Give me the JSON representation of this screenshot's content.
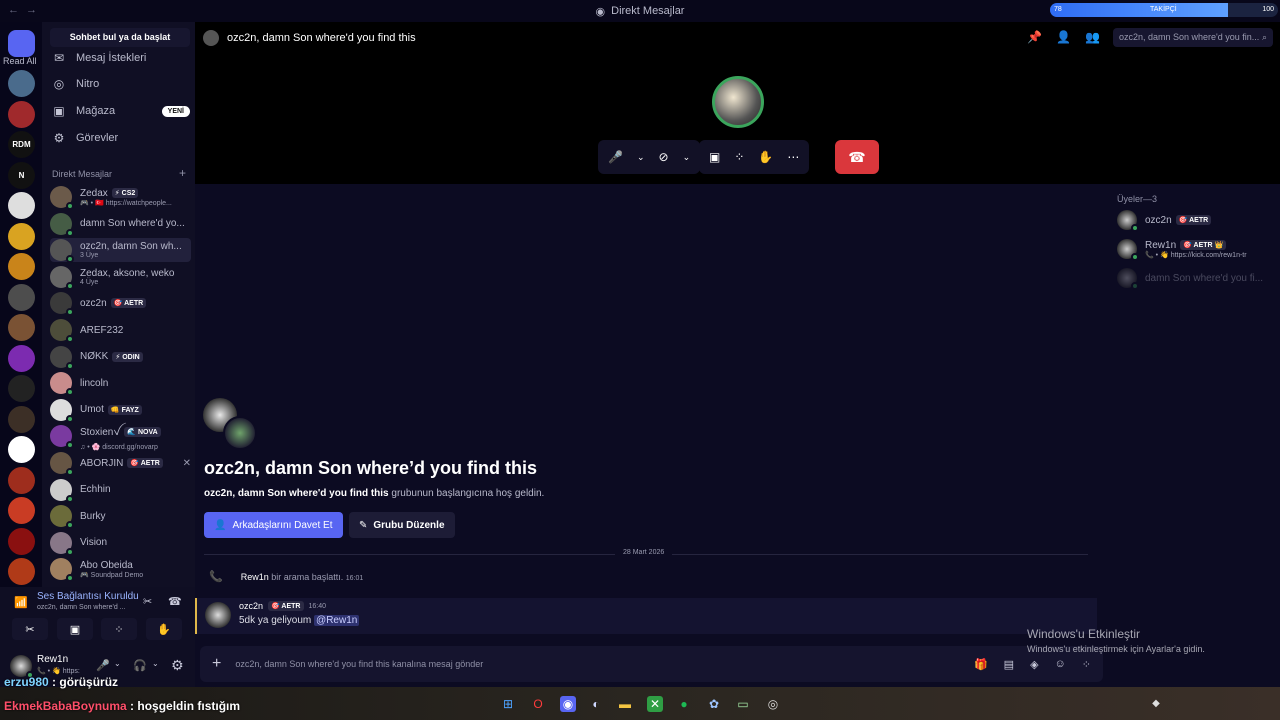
{
  "window": {
    "title": "Direkt Mesajlar",
    "nav": "← →"
  },
  "follower_bar": {
    "left": "78",
    "label": "TAKİPÇİ",
    "right": "100",
    "progress": 0.78
  },
  "servers": {
    "read_all": "Read All",
    "items": [
      {
        "name": "discord-home",
        "color": "#5865f2"
      },
      {
        "name": "server-1",
        "color": "#4a6b8c"
      },
      {
        "name": "server-2",
        "color": "#a0292c"
      },
      {
        "name": "server-rdm",
        "color": "#111",
        "text": "RDM"
      },
      {
        "name": "server-n",
        "color": "#111",
        "text": "N"
      },
      {
        "name": "server-5",
        "color": "#dedede"
      },
      {
        "name": "server-6",
        "color": "#d9a321"
      },
      {
        "name": "server-7",
        "color": "#c9841a"
      },
      {
        "name": "server-8",
        "color": "#4d4d4d"
      },
      {
        "name": "server-9",
        "color": "#7a5234"
      },
      {
        "name": "server-10",
        "color": "#7c2bb0"
      },
      {
        "name": "server-11",
        "color": "#222"
      },
      {
        "name": "server-12",
        "color": "#3c2f26"
      },
      {
        "name": "server-13",
        "color": "#fff"
      },
      {
        "name": "server-14",
        "color": "#9e2d1d"
      },
      {
        "name": "server-15",
        "color": "#c93c24"
      },
      {
        "name": "server-16",
        "color": "#8a1010"
      },
      {
        "name": "server-17",
        "color": "#b03a18"
      }
    ]
  },
  "sidebar": {
    "find": "Sohbet bul ya da başlat",
    "nav": [
      {
        "label": "Mesaj İstekleri",
        "icon": "✉"
      },
      {
        "label": "Nitro",
        "icon": "◎"
      },
      {
        "label": "Mağaza",
        "icon": "▣",
        "badge": "YENİ"
      },
      {
        "label": "Görevler",
        "icon": "⚙"
      }
    ],
    "dm_header": "Direkt Mesajlar",
    "dm_add": "+",
    "dms": [
      {
        "name": "Zedax",
        "tag": "⚡ CS2",
        "sub": "🎮 • 🇹🇷 https://watchpeople...",
        "color": "#6b5a4a"
      },
      {
        "name": "damn Son where'd yo...",
        "tag": "",
        "sub": "",
        "color": "#455c45"
      },
      {
        "name": "ozc2n, damn Son wh...",
        "tag": "",
        "sub": "3 Üye",
        "color": "#555",
        "sel": true
      },
      {
        "name": "Zedax, aksone, weko",
        "tag": "",
        "sub": "4 Üye",
        "color": "#666"
      },
      {
        "name": "ozc2n",
        "tag": "🎯 AETR",
        "sub": "",
        "color": "#3a3a3a"
      },
      {
        "name": "AREF232",
        "tag": "",
        "sub": "",
        "color": "#4d4d3a"
      },
      {
        "name": "NØKK",
        "tag": "⚡ ODIN",
        "sub": "",
        "color": "#444"
      },
      {
        "name": "lincoln",
        "tag": "",
        "sub": "",
        "color": "#c98c8c"
      },
      {
        "name": "Umot",
        "tag": "👊 FAYZ",
        "sub": "",
        "color": "#ddd"
      },
      {
        "name": "Stoxienꪜ",
        "tag": "🌊 NOVA",
        "sub": "♫ • 🌸 discord.gg/novarp",
        "color": "#7a3aa0"
      },
      {
        "name": "ABORJİN",
        "tag": "🎯 AETR",
        "sub": "",
        "color": "#665544",
        "x": "✕"
      },
      {
        "name": "Echhin",
        "tag": "",
        "sub": "",
        "color": "#ccc"
      },
      {
        "name": "Burky",
        "tag": "",
        "sub": "",
        "color": "#6b6b3a"
      },
      {
        "name": "Vision",
        "tag": "",
        "sub": "",
        "color": "#887788"
      },
      {
        "name": "Abo Obeida",
        "tag": "",
        "sub": "🎮 Soundpad Demo",
        "color": "#a08060"
      }
    ]
  },
  "voice": {
    "title": "Ses Bağlantısı Kuruldu",
    "sub": "ozc2n, damn Son where'd ...",
    "buttons": [
      "✂",
      "▣",
      "⁘",
      "✋"
    ]
  },
  "user": {
    "name": "Rew1n",
    "status": "📞 • 👋 https:"
  },
  "channel": {
    "name": "ozc2n, damn Son where'd you find this",
    "search": "ozc2n, damn Son where'd you fin..."
  },
  "call_controls": {
    "mic": "🎤",
    "cam": "⊘",
    "share": "▣",
    "apps": "⁘",
    "activity": "✋",
    "more": "⋯",
    "hangup": "☎"
  },
  "members": {
    "header": "Üyeler—3",
    "list": [
      {
        "name": "ozc2n",
        "tag": "🎯 AETR",
        "sub": ""
      },
      {
        "name": "Rew1n",
        "tag": "🎯 AETR 👑",
        "sub": "📞 • 👋 https://kick.com/rew1n-tr"
      },
      {
        "name": "damn Son where'd you fi...",
        "tag": "",
        "sub": "",
        "dim": true
      }
    ]
  },
  "welcome": {
    "title": "ozc2n, damn Son where’d you find this",
    "sub_bold": "ozc2n, damn Son where'd you find this",
    "sub_rest": " grubunun başlangıcına hoş geldin.",
    "invite": "Arkadaşlarını Davet Et",
    "edit": "Grubu Düzenle"
  },
  "date_divider": "28 Mart 2026",
  "system_message": {
    "user": "Rew1n",
    "text": " bir arama başlattı.",
    "time": "16:01"
  },
  "message": {
    "user": "ozc2n",
    "tag": "🎯 AETR",
    "time": "16:40",
    "body": "5dk ya geliyoum ",
    "mention": "@Rew1n"
  },
  "composer": {
    "placeholder": "ozc2n, damn Son where'd you find this kanalına mesaj gönder"
  },
  "activation": {
    "title": "Windows'u Etkinleştir",
    "sub": "Windows'u etkinleştirmek için Ayarlar'a gidin."
  },
  "chat_overlay": [
    {
      "user": "erzu980",
      "text": " : görüşürüz",
      "color": "#ffffff"
    },
    {
      "user": "EkmekBabaBoynuma",
      "text": " : hoşgeldin fıstığım",
      "color": "#ff4f6a"
    }
  ]
}
